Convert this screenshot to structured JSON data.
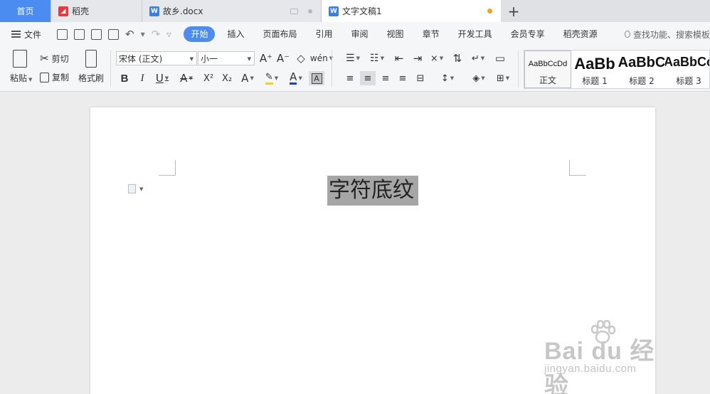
{
  "tabs": [
    {
      "label": "首页"
    },
    {
      "label": "稻壳"
    },
    {
      "label": "故乡.docx"
    },
    {
      "label": "文字文稿1"
    }
  ],
  "new_tab_label": "+",
  "menu": {
    "file": "文件",
    "items": [
      "开始",
      "插入",
      "页面布局",
      "引用",
      "审阅",
      "视图",
      "章节",
      "开发工具",
      "会员专享",
      "稻壳资源"
    ],
    "active": "开始",
    "search_placeholder": "查找功能、搜索模板"
  },
  "ribbon": {
    "paste": "粘贴",
    "cut": "剪切",
    "copy": "复制",
    "format_painter": "格式刷",
    "font_name": "宋体 (正文)",
    "font_size": "小一",
    "bold": "B",
    "italic": "I",
    "underline": "U",
    "strikethrough": "A",
    "superscript": "X²",
    "subscript": "X₂",
    "text_effect": "A",
    "font_color": "A",
    "char_shading": "A",
    "grow_font": "A⁺",
    "shrink_font": "A⁻",
    "pinyin": "wén",
    "styles": [
      {
        "preview": "AaBbCcDd",
        "label": "正文"
      },
      {
        "preview": "AaBb",
        "label": "标题 1"
      },
      {
        "preview": "AaBbC",
        "label": "标题 2"
      },
      {
        "preview": "AaBbCc",
        "label": "标题 3"
      }
    ]
  },
  "document": {
    "text": "字符底纹"
  },
  "watermark": {
    "brand": "Bai du 经验",
    "url": "jingyan.baidu.com"
  },
  "colors": {
    "accent": "#4a8cf0",
    "highlight": "#a6a6a6",
    "unsaved_dot": "#f1a326"
  }
}
